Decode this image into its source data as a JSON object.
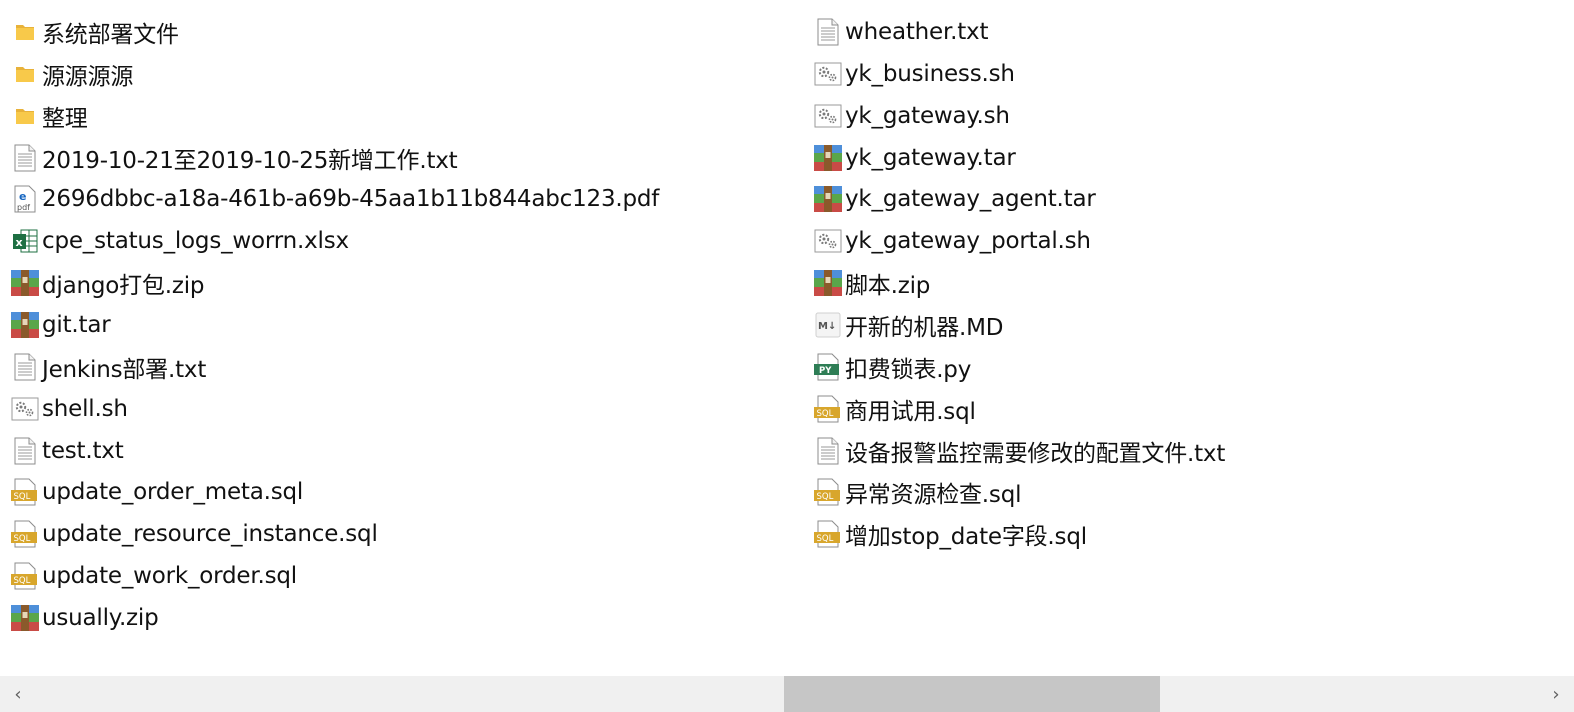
{
  "files": [
    {
      "name": "系统部署文件",
      "icon": "folder-icon",
      "type": "folder"
    },
    {
      "name": "源源源源",
      "icon": "folder-icon",
      "type": "folder"
    },
    {
      "name": "整理",
      "icon": "folder-icon",
      "type": "folder"
    },
    {
      "name": "2019-10-21至2019-10-25新增工作.txt",
      "icon": "text-file-icon",
      "type": "txt"
    },
    {
      "name": "2696dbbc-a18a-461b-a69b-45aa1b11b844abc123.pdf",
      "icon": "pdf-file-icon",
      "type": "pdf"
    },
    {
      "name": "cpe_status_logs_worrn.xlsx",
      "icon": "excel-file-icon",
      "type": "xlsx"
    },
    {
      "name": "django打包.zip",
      "icon": "archive-file-icon",
      "type": "archive"
    },
    {
      "name": "git.tar",
      "icon": "archive-file-icon",
      "type": "archive"
    },
    {
      "name": "Jenkins部署.txt",
      "icon": "text-file-icon",
      "type": "txt"
    },
    {
      "name": "shell.sh",
      "icon": "script-file-icon",
      "type": "sh"
    },
    {
      "name": "test.txt",
      "icon": "text-file-icon",
      "type": "txt"
    },
    {
      "name": "update_order_meta.sql",
      "icon": "sql-file-icon",
      "type": "sql"
    },
    {
      "name": "update_resource_instance.sql",
      "icon": "sql-file-icon",
      "type": "sql"
    },
    {
      "name": "update_work_order.sql",
      "icon": "sql-file-icon",
      "type": "sql"
    },
    {
      "name": "usually.zip",
      "icon": "archive-file-icon",
      "type": "archive"
    },
    {
      "name": "wheather.txt",
      "icon": "text-file-icon",
      "type": "txt"
    },
    {
      "name": "yk_business.sh",
      "icon": "script-file-icon",
      "type": "sh"
    },
    {
      "name": "yk_gateway.sh",
      "icon": "script-file-icon",
      "type": "sh"
    },
    {
      "name": "yk_gateway.tar",
      "icon": "archive-file-icon",
      "type": "archive"
    },
    {
      "name": "yk_gateway_agent.tar",
      "icon": "archive-file-icon",
      "type": "archive"
    },
    {
      "name": "yk_gateway_portal.sh",
      "icon": "script-file-icon",
      "type": "sh"
    },
    {
      "name": "脚本.zip",
      "icon": "archive-file-icon",
      "type": "archive"
    },
    {
      "name": "开新的机器.MD",
      "icon": "markdown-file-icon",
      "type": "md"
    },
    {
      "name": "扣费锁表.py",
      "icon": "python-file-icon",
      "type": "py"
    },
    {
      "name": "商用试用.sql",
      "icon": "sql-file-icon",
      "type": "sql"
    },
    {
      "name": "设备报警监控需要修改的配置文件.txt",
      "icon": "text-file-icon",
      "type": "txt"
    },
    {
      "name": "异常资源检查.sql",
      "icon": "sql-file-icon",
      "type": "sql"
    },
    {
      "name": "增加stop_date字段.sql",
      "icon": "sql-file-icon",
      "type": "sql"
    }
  ],
  "scrollbar": {
    "left_arrow": "‹",
    "right_arrow": "›",
    "position": 0.5
  },
  "colors": {
    "folder": "#f8c94a",
    "sql_badge": "#d8a62c",
    "excel": "#1d6f42",
    "python_badge": "#2e7d55",
    "pdf_text": "#1565c0",
    "scrollbar_track": "#f0f0f0",
    "scrollbar_thumb": "#c6c6c6"
  }
}
